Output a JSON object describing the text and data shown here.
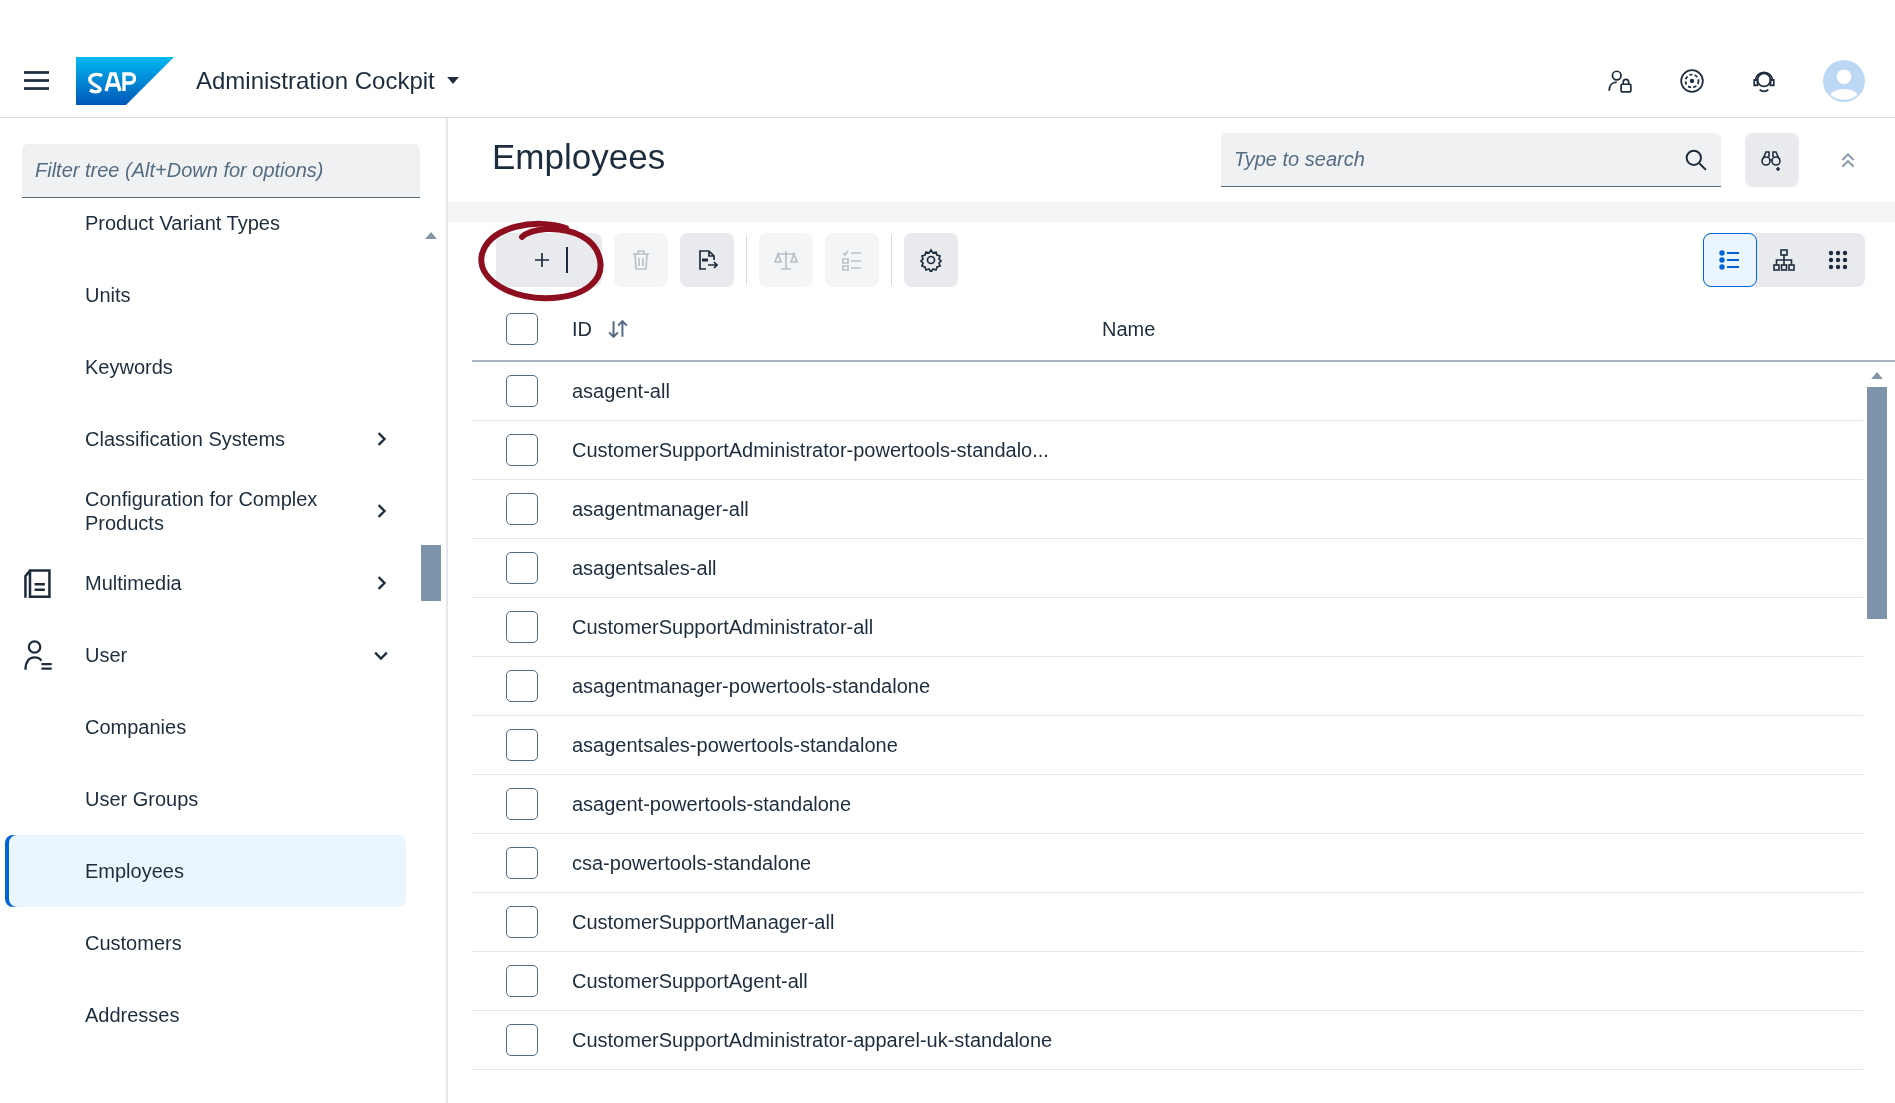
{
  "shell": {
    "title": "Administration Cockpit"
  },
  "sidebar": {
    "filter": {
      "placeholder": "Filter tree (Alt+Down for options)"
    },
    "items": [
      {
        "label": "Product Variant Types",
        "selected": false
      },
      {
        "label": "Units",
        "selected": false
      },
      {
        "label": "Keywords",
        "selected": false
      },
      {
        "label": "Classification Systems",
        "selected": false,
        "expanded": false
      },
      {
        "label": "Configuration for Complex Products",
        "selected": false,
        "expanded": false
      },
      {
        "label": "Multimedia",
        "selected": false,
        "expanded": false,
        "kind": "media"
      },
      {
        "label": "User",
        "selected": false,
        "expanded": true,
        "kind": "user",
        "children": [
          {
            "label": "Companies",
            "selected": false
          },
          {
            "label": "User Groups",
            "selected": false
          },
          {
            "label": "Employees",
            "selected": true
          },
          {
            "label": "Customers",
            "selected": false
          },
          {
            "label": "Addresses",
            "selected": false
          }
        ]
      }
    ]
  },
  "page": {
    "title": "Employees",
    "search": {
      "placeholder": "Type to search"
    }
  },
  "toolbar": {
    "buttons": [
      {
        "kind": "add",
        "disabled": false
      },
      {
        "kind": "delete",
        "disabled": true
      },
      {
        "kind": "export",
        "disabled": false
      },
      {
        "kind": "compare",
        "disabled": true
      },
      {
        "kind": "checklist",
        "disabled": true
      },
      {
        "kind": "settings",
        "disabled": false
      }
    ],
    "views": [
      {
        "kind": "list",
        "selected": true
      },
      {
        "kind": "tree",
        "selected": false
      },
      {
        "kind": "grid",
        "selected": false
      }
    ]
  },
  "table": {
    "select_all": {
      "checked": false
    },
    "columns": [
      {
        "label": "ID",
        "sortable": true
      },
      {
        "label": "Name",
        "sortable": false
      }
    ],
    "rows": [
      {
        "id": "asagent-all",
        "checked": false
      },
      {
        "id": "CustomerSupportAdministrator-powertools-standalo...",
        "checked": false
      },
      {
        "id": "asagentmanager-all",
        "checked": false
      },
      {
        "id": "asagentsales-all",
        "checked": false
      },
      {
        "id": "CustomerSupportAdministrator-all",
        "checked": false
      },
      {
        "id": "asagentmanager-powertools-standalone",
        "checked": false
      },
      {
        "id": "asagentsales-powertools-standalone",
        "checked": false
      },
      {
        "id": "asagent-powertools-standalone",
        "checked": false
      },
      {
        "id": "csa-powertools-standalone",
        "checked": false
      },
      {
        "id": "CustomerSupportManager-all",
        "checked": false
      },
      {
        "id": "CustomerSupportAgent-all",
        "checked": false
      },
      {
        "id": "CustomerSupportAdministrator-apparel-uk-standalone",
        "checked": false
      }
    ]
  }
}
